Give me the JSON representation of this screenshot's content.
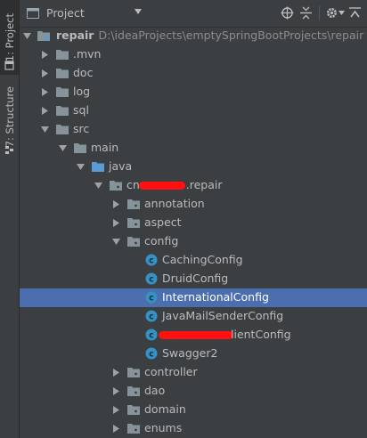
{
  "sidebar": {
    "project_tab": "1: Project",
    "structure_tab": "7: Structure"
  },
  "header": {
    "title": "Project",
    "icons": [
      "target-icon",
      "collapse-icon",
      "gear-icon",
      "hide-icon"
    ]
  },
  "tree": {
    "root_name": "repair",
    "root_path": "D:\\ideaProjects\\emptySpringBootProjects\\repair",
    "items": [
      {
        "label": "repair",
        "type": "module",
        "expanded": true
      },
      {
        "label": ".mvn",
        "type": "folder",
        "expanded": false
      },
      {
        "label": "doc",
        "type": "folder",
        "expanded": false
      },
      {
        "label": "log",
        "type": "folder",
        "expanded": false
      },
      {
        "label": "sql",
        "type": "folder",
        "expanded": false
      },
      {
        "label": "src",
        "type": "folder",
        "expanded": true
      },
      {
        "label": "main",
        "type": "folder",
        "expanded": true
      },
      {
        "label": "java",
        "type": "source-folder",
        "expanded": true
      },
      {
        "label_prefix": "cn.",
        "label_suffix": ".repair",
        "type": "package",
        "expanded": true
      },
      {
        "label": "annotation",
        "type": "package",
        "expanded": false
      },
      {
        "label": "aspect",
        "type": "package",
        "expanded": false
      },
      {
        "label": "config",
        "type": "package",
        "expanded": true
      },
      {
        "label": "CachingConfig",
        "type": "class"
      },
      {
        "label": "DruidConfig",
        "type": "class"
      },
      {
        "label": "InternationalConfig",
        "type": "class",
        "selected": true
      },
      {
        "label": "JavaMailSenderConfig",
        "type": "class"
      },
      {
        "label": "lientConfig",
        "type": "class"
      },
      {
        "label": "Swagger2",
        "type": "class"
      },
      {
        "label": "controller",
        "type": "package",
        "expanded": false
      },
      {
        "label": "dao",
        "type": "package",
        "expanded": false
      },
      {
        "label": "domain",
        "type": "package",
        "expanded": false
      },
      {
        "label": "enums",
        "type": "package",
        "expanded": false
      }
    ]
  },
  "colors": {
    "background": "#3c3f41",
    "selection": "#4b6eaf",
    "folder": "#87939a",
    "source_folder": "#5b9bd5",
    "class_icon": "#3592c4",
    "redaction": "#ff1111"
  }
}
